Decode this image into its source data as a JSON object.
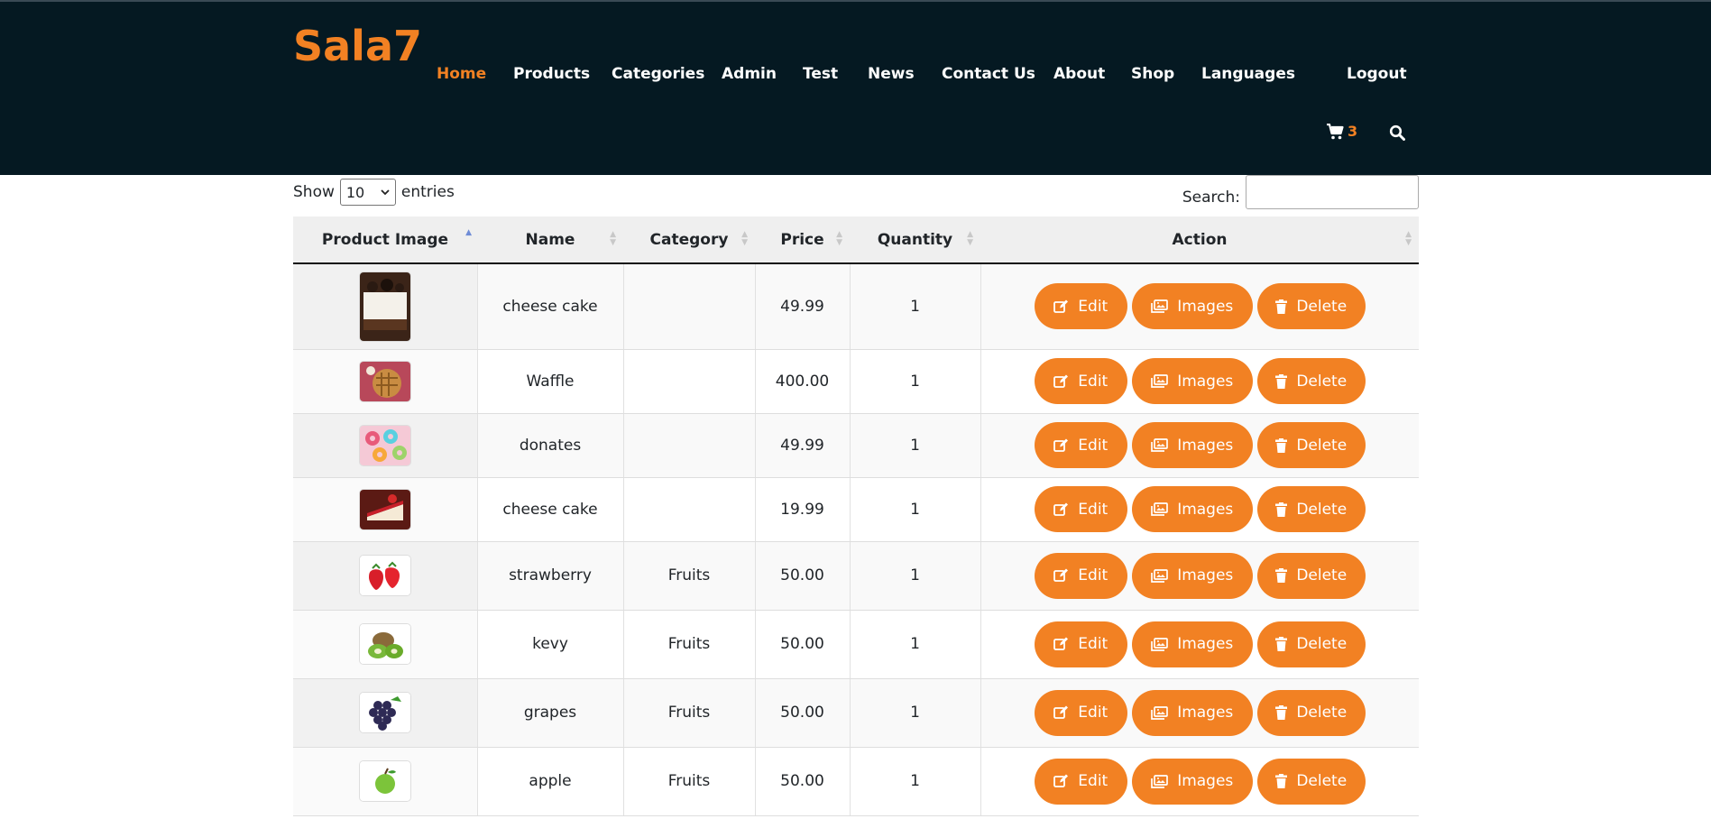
{
  "brand": {
    "logo": "Sala7",
    "accent": "#f28123",
    "header_bg": "#051922"
  },
  "nav": {
    "items": [
      {
        "label": "Home",
        "active": true
      },
      {
        "label": "Products"
      },
      {
        "label": "Categories"
      },
      {
        "label": "Admin"
      },
      {
        "label": "Test"
      },
      {
        "label": "News"
      },
      {
        "label": "Contact Us"
      },
      {
        "label": "About"
      },
      {
        "label": "Shop"
      },
      {
        "label": "Languages"
      },
      {
        "label": "Logout"
      }
    ],
    "cart_count": "3",
    "cart_icon": "shopping-cart-icon",
    "search_icon": "search-icon"
  },
  "controls": {
    "show_label": "Show",
    "entries_value": "10",
    "entries_label": "entries",
    "search_label": "Search:",
    "search_value": ""
  },
  "table": {
    "headers": [
      "Product Image",
      "Name",
      "Category",
      "Price",
      "Quantity",
      "Action"
    ],
    "rows": [
      {
        "image": "cheesecake-oreo",
        "name": "cheese cake",
        "category": "",
        "price": "49.99",
        "quantity": "1"
      },
      {
        "image": "waffle",
        "name": "Waffle",
        "category": "",
        "price": "400.00",
        "quantity": "1"
      },
      {
        "image": "donuts",
        "name": "donates",
        "category": "",
        "price": "49.99",
        "quantity": "1"
      },
      {
        "image": "cheesecake-strawberry",
        "name": "cheese cake",
        "category": "",
        "price": "19.99",
        "quantity": "1"
      },
      {
        "image": "strawberry",
        "name": "strawberry",
        "category": "Fruits",
        "price": "50.00",
        "quantity": "1"
      },
      {
        "image": "kiwi",
        "name": "kevy",
        "category": "Fruits",
        "price": "50.00",
        "quantity": "1"
      },
      {
        "image": "grapes",
        "name": "grapes",
        "category": "Fruits",
        "price": "50.00",
        "quantity": "1"
      },
      {
        "image": "apple",
        "name": "apple",
        "category": "Fruits",
        "price": "50.00",
        "quantity": "1"
      }
    ],
    "actions": {
      "edit": "Edit",
      "images": "Images",
      "delete": "Delete"
    }
  }
}
